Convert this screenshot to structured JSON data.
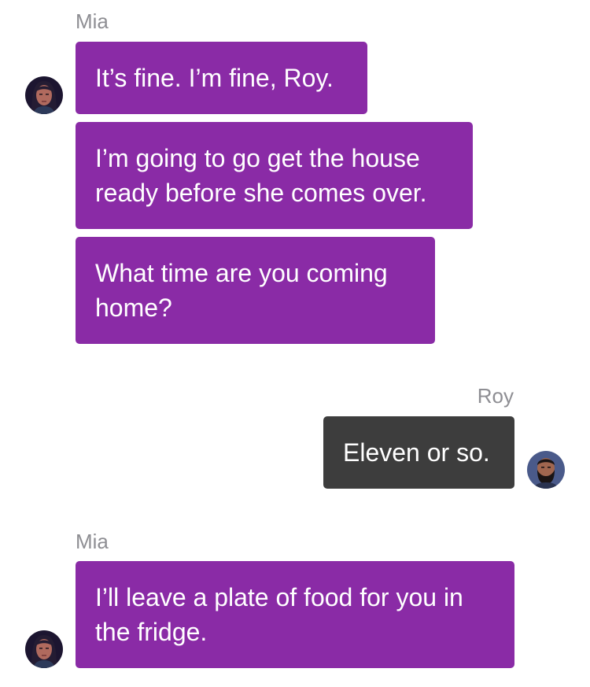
{
  "conversation": {
    "groups": [
      {
        "sender": "Mia",
        "avatar": "mia-avatar",
        "messages": [
          "It’s fine. I’m fine, Roy.",
          "I’m going to go get the house ready before she comes over.",
          "What time are you coming home?"
        ]
      },
      {
        "sender": "Roy",
        "avatar": "roy-avatar",
        "messages": [
          "Eleven or so."
        ]
      },
      {
        "sender": "Mia",
        "avatar": "mia-avatar",
        "messages": [
          "I’ll leave a plate of food for you in the fridge."
        ]
      }
    ]
  },
  "colors": {
    "mia_bubble": "#8a2ba6",
    "roy_bubble": "#3d3d3d",
    "sender_label": "#8e8e93",
    "background": "#ffffff"
  }
}
